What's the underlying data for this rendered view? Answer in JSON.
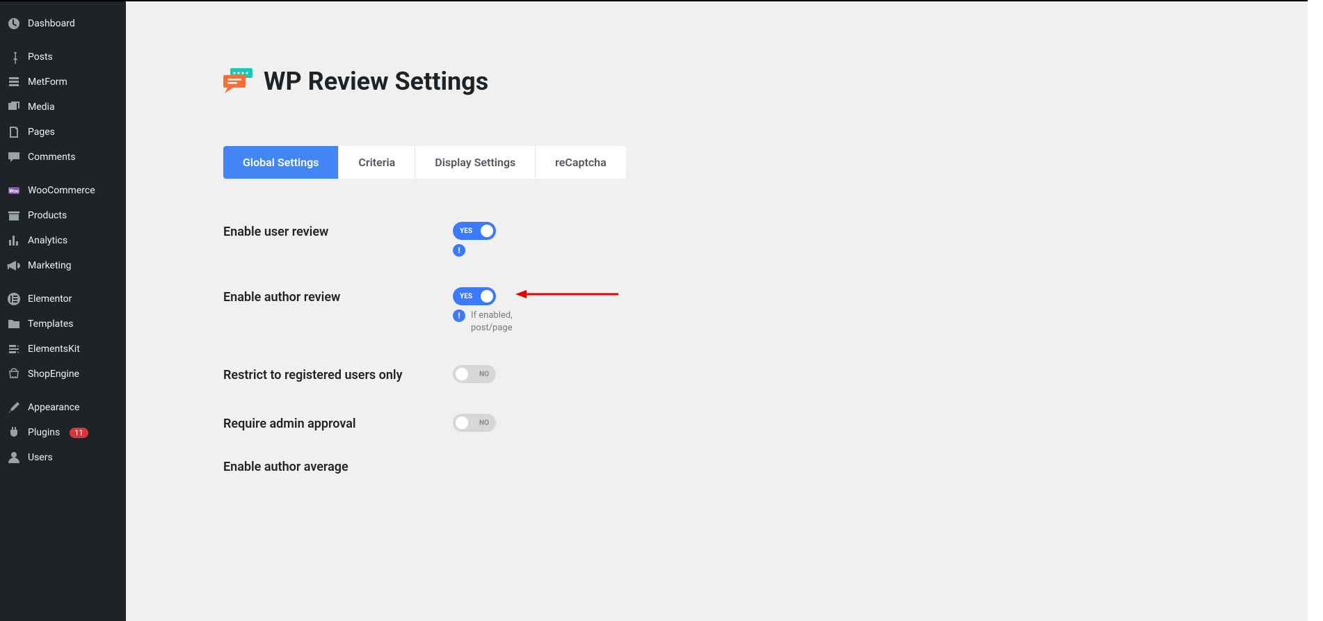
{
  "sidebar": {
    "items": [
      {
        "label": "Dashboard"
      },
      {
        "label": "Posts"
      },
      {
        "label": "MetForm"
      },
      {
        "label": "Media"
      },
      {
        "label": "Pages"
      },
      {
        "label": "Comments"
      },
      {
        "label": "WooCommerce"
      },
      {
        "label": "Products"
      },
      {
        "label": "Analytics"
      },
      {
        "label": "Marketing"
      },
      {
        "label": "Elementor"
      },
      {
        "label": "Templates"
      },
      {
        "label": "ElementsKit"
      },
      {
        "label": "ShopEngine"
      },
      {
        "label": "Appearance"
      },
      {
        "label": "Plugins"
      },
      {
        "label": "Users"
      }
    ],
    "plugins_badge": "11"
  },
  "page": {
    "title": "WP Review Settings"
  },
  "tabs": [
    {
      "label": "Global Settings",
      "active": true
    },
    {
      "label": "Criteria",
      "active": false
    },
    {
      "label": "Display Settings",
      "active": false
    },
    {
      "label": "reCaptcha",
      "active": false
    }
  ],
  "settings": {
    "enable_user_review": {
      "label": "Enable user review",
      "state": "on",
      "text": "YES"
    },
    "enable_author_review": {
      "label": "Enable author review",
      "state": "on",
      "text": "YES",
      "hint": "If enabled, post/page"
    },
    "restrict_registered": {
      "label": "Restrict to registered users only",
      "state": "off",
      "text": "NO"
    },
    "require_admin_approval": {
      "label": "Require admin approval",
      "state": "off",
      "text": "NO"
    },
    "enable_author_average": {
      "label": "Enable author average"
    }
  }
}
